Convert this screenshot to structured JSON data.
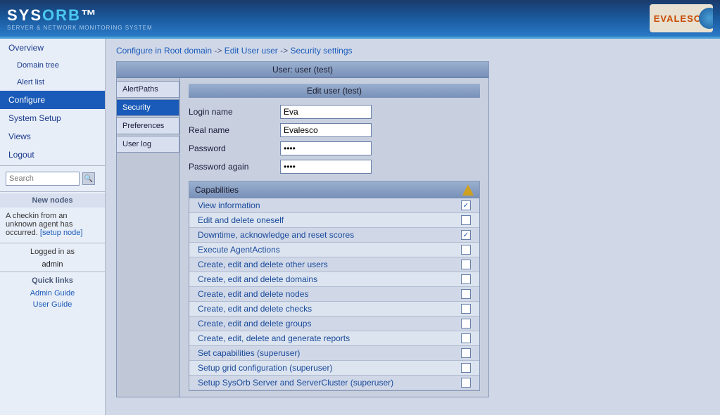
{
  "header": {
    "logo_text": "SYSORB",
    "logo_tm": "™",
    "logo_sub": "SERVER & NETWORK MONITORING SYSTEM",
    "evalesco_text": "EVALESCO"
  },
  "sidebar": {
    "items": [
      {
        "label": "Overview",
        "id": "overview",
        "sub": false,
        "active": false
      },
      {
        "label": "Domain tree",
        "id": "domain-tree",
        "sub": true,
        "active": false
      },
      {
        "label": "Alert list",
        "id": "alert-list",
        "sub": true,
        "active": false
      },
      {
        "label": "Configure",
        "id": "configure",
        "sub": false,
        "active": true
      },
      {
        "label": "System Setup",
        "id": "system-setup",
        "sub": false,
        "active": false
      },
      {
        "label": "Views",
        "id": "views",
        "sub": false,
        "active": false
      },
      {
        "label": "Logout",
        "id": "logout",
        "sub": false,
        "active": false
      }
    ],
    "search_placeholder": "Search",
    "new_nodes_label": "New nodes",
    "node_message": "A checkin from an unknown agent has occurred.",
    "setup_node_label": "[setup node]",
    "logged_in_label": "Logged in as",
    "logged_user": "admin",
    "quick_links_label": "Quick links",
    "quick_links": [
      {
        "label": "Admin Guide",
        "id": "admin-guide"
      },
      {
        "label": "User Guide",
        "id": "user-guide"
      }
    ]
  },
  "breadcrumb": {
    "parts": [
      {
        "label": "Configure in Root domain",
        "id": "configure-root"
      },
      {
        "label": "Edit User user",
        "id": "edit-user"
      },
      {
        "label": "Security settings",
        "id": "security-settings"
      }
    ]
  },
  "panel": {
    "title": "User: user (test)",
    "form_title": "Edit user (test)",
    "tabs": [
      {
        "label": "AlertPaths",
        "id": "alertpaths",
        "active": false
      },
      {
        "label": "Security",
        "id": "security",
        "active": true
      },
      {
        "label": "Preferences",
        "id": "preferences",
        "active": false
      },
      {
        "label": "User log",
        "id": "userlog",
        "active": false
      }
    ],
    "fields": [
      {
        "label": "Login name",
        "value": "Eva",
        "type": "text",
        "id": "login-name"
      },
      {
        "label": "Real name",
        "value": "Evalesco",
        "type": "text",
        "id": "real-name"
      },
      {
        "label": "Password",
        "value": "••••",
        "type": "password",
        "id": "password"
      },
      {
        "label": "Password again",
        "value": "••••",
        "type": "password",
        "id": "password-again"
      }
    ],
    "capabilities_title": "Capabilities",
    "capabilities": [
      {
        "label": "View information",
        "checked": true,
        "id": "view-info"
      },
      {
        "label": "Edit and delete oneself",
        "checked": false,
        "id": "edit-delete-self"
      },
      {
        "label": "Downtime, acknowledge and reset scores",
        "checked": true,
        "id": "downtime-ack"
      },
      {
        "label": "Execute AgentActions",
        "checked": false,
        "id": "exec-agent"
      },
      {
        "label": "Create, edit and delete other users",
        "checked": false,
        "id": "create-users"
      },
      {
        "label": "Create, edit and delete domains",
        "checked": false,
        "id": "create-domains"
      },
      {
        "label": "Create, edit and delete nodes",
        "checked": false,
        "id": "create-nodes"
      },
      {
        "label": "Create, edit and delete checks",
        "checked": false,
        "id": "create-checks"
      },
      {
        "label": "Create, edit and delete groups",
        "checked": false,
        "id": "create-groups"
      },
      {
        "label": "Create, edit, delete and generate reports",
        "checked": false,
        "id": "create-reports"
      },
      {
        "label": "Set capabilities (superuser)",
        "checked": false,
        "id": "set-caps"
      },
      {
        "label": "Setup grid configuration (superuser)",
        "checked": false,
        "id": "setup-grid"
      },
      {
        "label": "Setup SysOrb Server and ServerCluster (superuser)",
        "checked": false,
        "id": "setup-server"
      }
    ]
  }
}
